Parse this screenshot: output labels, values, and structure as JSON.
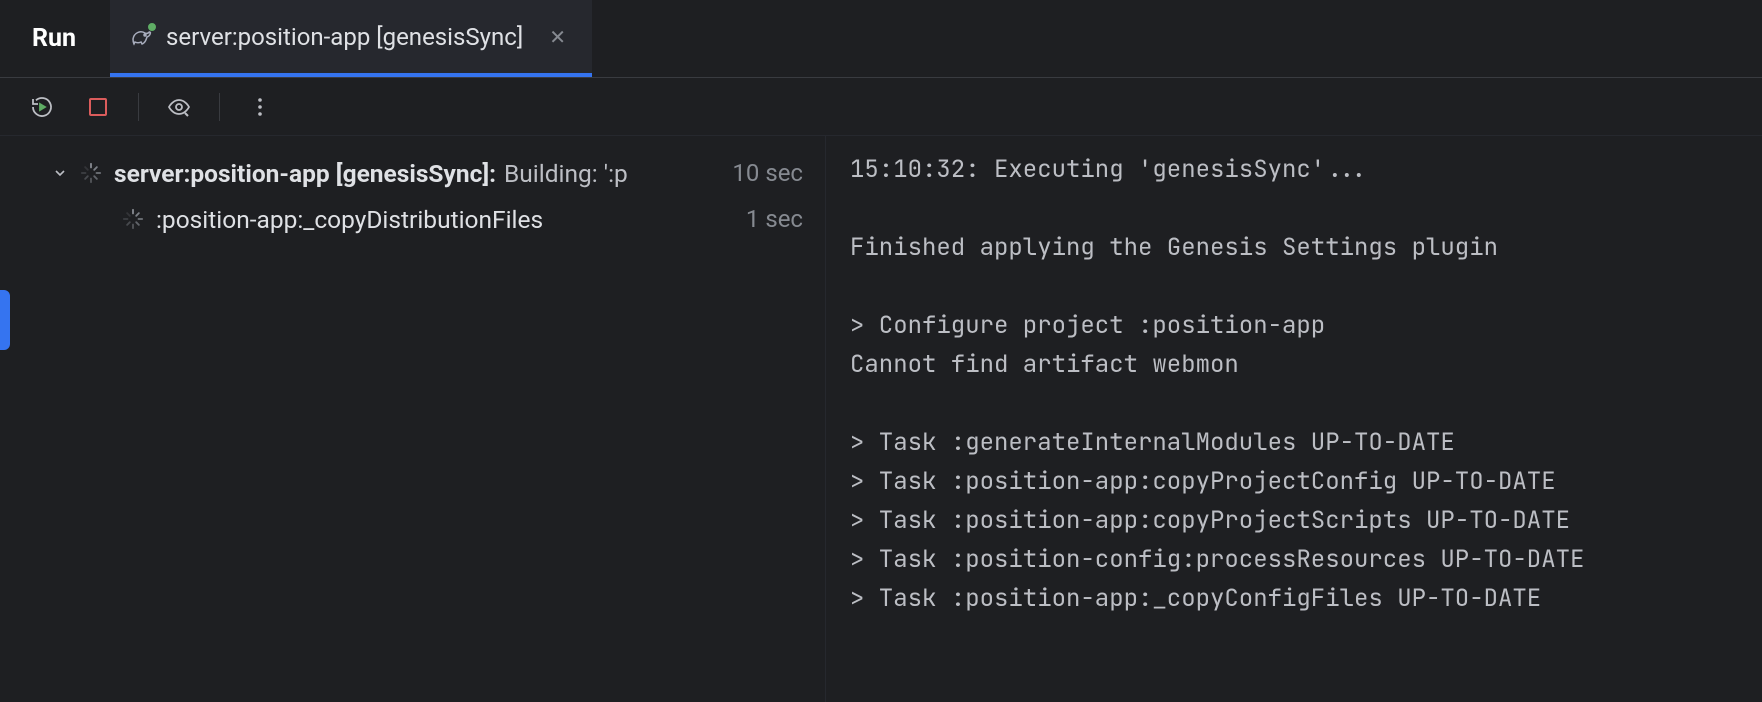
{
  "tabBar": {
    "title": "Run",
    "activeTab": {
      "label": "server:position-app [genesisSync]"
    }
  },
  "tree": {
    "root": {
      "name": "server:position-app [genesisSync]:",
      "status": "Building: ':p",
      "duration": "10 sec"
    },
    "child": {
      "name": ":position-app:_copyDistributionFiles",
      "duration": "1 sec"
    }
  },
  "console": {
    "lines": [
      "15:10:32: Executing 'genesisSync'...",
      "",
      "Finished applying the Genesis Settings plugin",
      "",
      "> Configure project :position-app",
      "Cannot find artifact webmon",
      "",
      "> Task :generateInternalModules UP-TO-DATE",
      "> Task :position-app:copyProjectConfig UP-TO-DATE",
      "> Task :position-app:copyProjectScripts UP-TO-DATE",
      "> Task :position-config:processResources UP-TO-DATE",
      "> Task :position-app:_copyConfigFiles UP-TO-DATE"
    ]
  }
}
